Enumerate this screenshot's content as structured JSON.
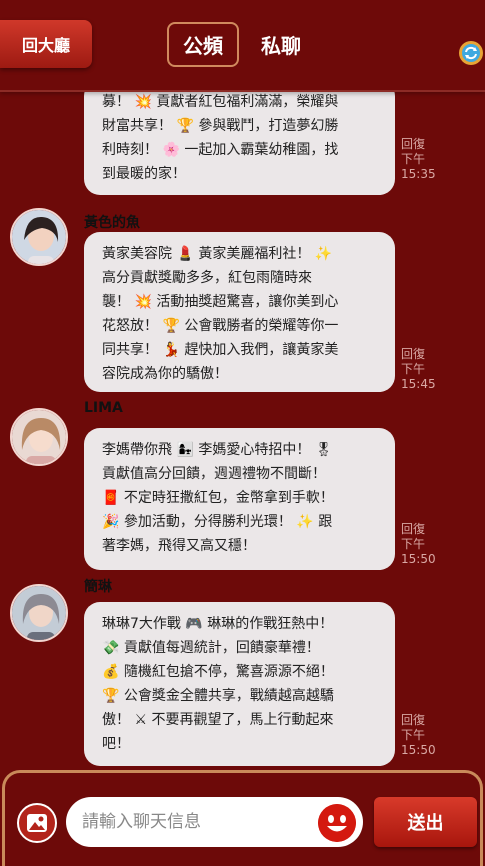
{
  "header": {
    "back_label": "回大廳",
    "tabs": [
      {
        "label": "公頻",
        "active": true
      },
      {
        "label": "私聊",
        "active": false
      }
    ],
    "refresh_icon": "refresh-icon"
  },
  "messages": [
    {
      "sender": "",
      "avatar_icon": "",
      "lines": [
        "募！ 💥 貢獻者紅包福利滿滿，榮耀與",
        "財富共享！ 🏆 參與戰鬥，打造夢幻勝",
        "利時刻！ 🌸 一起加入霸葉幼稚園，找",
        "到最暖的家！"
      ],
      "reply": "回復",
      "time_day": "下午",
      "time": "15:35"
    },
    {
      "sender": "黃色的魚",
      "avatar_icon": "user-avatar-icon",
      "lines": [
        "黃家美容院 💄 黃家美麗福利社！ ✨",
        "高分貢獻獎勵多多，紅包雨隨時來",
        "襲！ 💥 活動抽獎超驚喜，讓你美到心",
        "花怒放！ 🏆 公會戰勝者的榮耀等你一",
        "同共享！ 💃 趕快加入我們，讓黃家美",
        "容院成為你的驕傲！"
      ],
      "reply": "回復",
      "time_day": "下午",
      "time": "15:45"
    },
    {
      "sender": "LIMA",
      "avatar_icon": "user-avatar-icon",
      "lines": [
        "李媽帶你飛 👩‍👧 李媽愛心特招中！ 🎖",
        "貢獻值高分回饋，週週禮物不間斷！",
        "🧧 不定時狂撒紅包，金幣拿到手軟！",
        "🎉 參加活動，分得勝利光環！ ✨ 跟",
        "著李媽，飛得又高又穩！"
      ],
      "reply": "回復",
      "time_day": "下午",
      "time": "15:50"
    },
    {
      "sender": "簡琳",
      "avatar_icon": "user-avatar-icon",
      "lines": [
        "琳琳7大作戰 🎮 琳琳的作戰狂熱中！",
        "💸 貢獻值每週統計，回饋豪華禮！",
        "💰 隨機紅包搶不停，驚喜源源不絕！",
        "🏆 公會獎金全體共享，戰績越高越驕",
        "傲！ ⚔ 不要再觀望了，馬上行動起來",
        "吧！"
      ],
      "reply": "回復",
      "time_day": "下午",
      "time": "15:50"
    }
  ],
  "footer": {
    "image_icon": "image-icon",
    "input_placeholder": "請輸入聊天信息",
    "input_value": "",
    "emoji_icon": "smiley-icon",
    "send_label": "送出"
  },
  "colors": {
    "background": "#6d0a09",
    "bubble": "#ebe7e8",
    "accent_border": "#c98a5a",
    "button_red": "#c0281c"
  }
}
